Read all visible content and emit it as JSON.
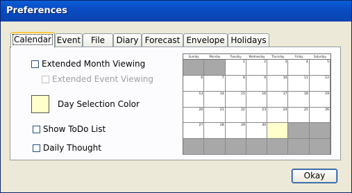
{
  "window": {
    "title": "Preferences"
  },
  "tabs": [
    {
      "label": "Calendar"
    },
    {
      "label": "Event"
    },
    {
      "label": "File"
    },
    {
      "label": "Diary"
    },
    {
      "label": "Forecast"
    },
    {
      "label": "Envelope"
    },
    {
      "label": "Holidays"
    }
  ],
  "options": {
    "extended_month": "Extended Month Viewing",
    "extended_event": "Extended Event Viewing",
    "day_color": "Day Selection Color",
    "show_todo": "Show ToDo List",
    "daily_thought": "Daily Thought"
  },
  "colors": {
    "day_selection": "#ffffcc",
    "gray_cell": "#a8a8a8"
  },
  "calendar_preview": {
    "weekdays": [
      "Sunday",
      "Monday",
      "Tuesday",
      "Wednesday",
      "Thursday",
      "Friday",
      "Saturday"
    ],
    "weeks": [
      [
        "",
        "",
        "1",
        "2",
        "3",
        "4",
        "5"
      ],
      [
        "6",
        "7",
        "8",
        "9",
        "10",
        "11",
        "12"
      ],
      [
        "13",
        "14",
        "15",
        "16",
        "17",
        "18",
        "19"
      ],
      [
        "20",
        "21",
        "22",
        "23",
        "24",
        "25",
        "26"
      ],
      [
        "27",
        "28",
        "29",
        "30",
        "",
        "",
        ""
      ],
      [
        "",
        "",
        "",
        "",
        "",
        "",
        ""
      ]
    ],
    "gray_cells": [
      [
        0,
        0
      ],
      [
        0,
        1
      ],
      [
        4,
        5
      ],
      [
        4,
        6
      ],
      [
        5,
        0
      ],
      [
        5,
        1
      ],
      [
        5,
        2
      ],
      [
        5,
        3
      ],
      [
        5,
        4
      ],
      [
        5,
        5
      ],
      [
        5,
        6
      ]
    ],
    "selected_cell": [
      4,
      4
    ]
  },
  "buttons": {
    "okay": "Okay"
  }
}
